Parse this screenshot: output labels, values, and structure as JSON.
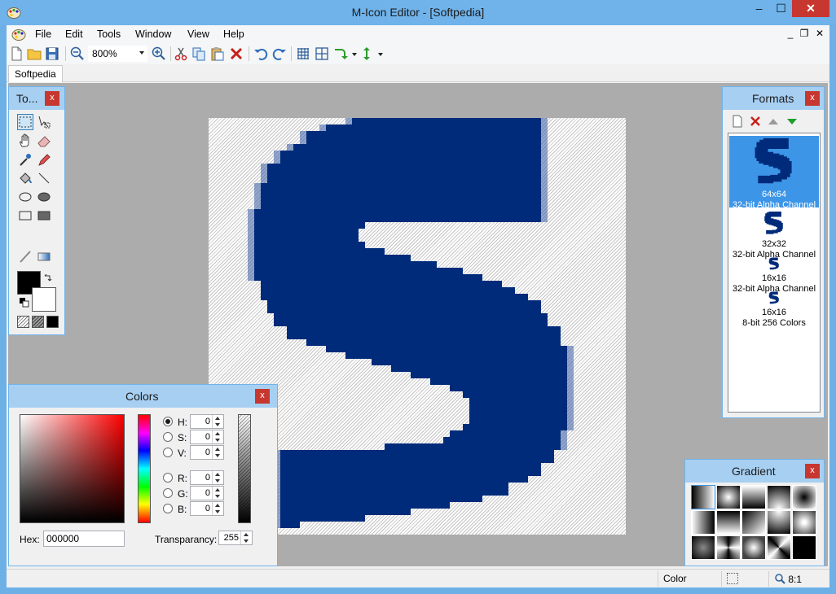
{
  "window": {
    "title": "M-Icon Editor - [Softpedia]",
    "min": "–",
    "max": "☐",
    "close": "✕"
  },
  "menu": {
    "items": [
      "File",
      "Edit",
      "Tools",
      "Window",
      "View",
      "Help"
    ]
  },
  "mdi": {
    "min": "_",
    "restore": "❐",
    "close": "✕"
  },
  "toolbar": {
    "zoom": "800%"
  },
  "tab": {
    "label": "Softpedia"
  },
  "tools": {
    "title": "To...",
    "close": "x"
  },
  "colors": {
    "title": "Colors",
    "close": "x",
    "h_label": "H:",
    "s_label": "S:",
    "v_label": "V:",
    "r_label": "R:",
    "g_label": "G:",
    "b_label": "B:",
    "h": "0",
    "s": "0",
    "v": "0",
    "r": "0",
    "g": "0",
    "b": "0",
    "hex_label": "Hex:",
    "hex": "000000",
    "transparency_label": "Transparancy:",
    "transparency": "255"
  },
  "formats": {
    "title": "Formats",
    "close": "x",
    "items": [
      {
        "size": "64x64",
        "depth": "32-bit Alpha Channel"
      },
      {
        "size": "32x32",
        "depth": "32-bit Alpha Channel"
      },
      {
        "size": "16x16",
        "depth": "32-bit Alpha Channel"
      },
      {
        "size": "16x16",
        "depth": "8-bit 256 Colors"
      }
    ]
  },
  "gradient": {
    "title": "Gradient",
    "close": "x"
  },
  "status": {
    "mode": "Color",
    "zoom": "8:1"
  },
  "palette": {
    "icon_blue": "#002b7a",
    "accent": "#6fb3ea",
    "close_red": "#c7372f"
  }
}
